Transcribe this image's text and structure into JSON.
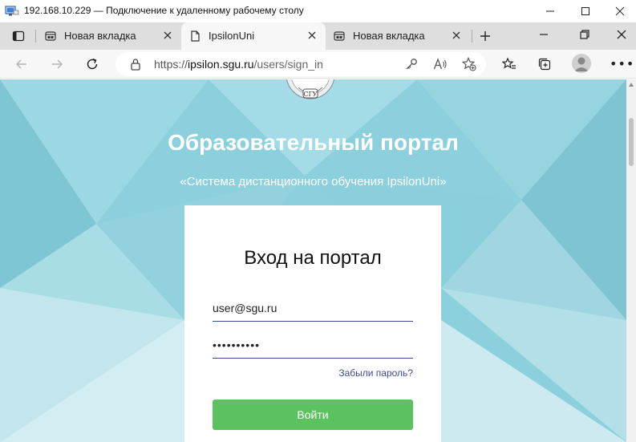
{
  "window": {
    "title": "192.168.10.229 — Подключение к удаленному рабочему столу",
    "icon": "rdp-icon"
  },
  "tabs": [
    {
      "label": "Новая вкладка",
      "icon": "new-tab-page-icon",
      "active": false
    },
    {
      "label": "IpsilonUni",
      "icon": "page-icon",
      "active": true
    },
    {
      "label": "Новая вкладка",
      "icon": "new-tab-page-icon",
      "active": false
    }
  ],
  "address_bar": {
    "url_prefix": "https://",
    "url_host": "ipsilon.sgu.ru",
    "url_path": "/users/sign_in"
  },
  "logo": {
    "text": "СГУ"
  },
  "page": {
    "title": "Образовательный портал",
    "subtitle": "«Система дистанционного обучения IpsilonUni»"
  },
  "login_form": {
    "heading": "Вход на портал",
    "email_value": "user@sgu.ru",
    "password_value": "••••••••••",
    "forgot_link": "Забыли пароль?",
    "submit_label": "Войти"
  },
  "colors": {
    "background": "#8dd0dd",
    "button": "#5cc25f",
    "link": "#3d4c8f"
  }
}
